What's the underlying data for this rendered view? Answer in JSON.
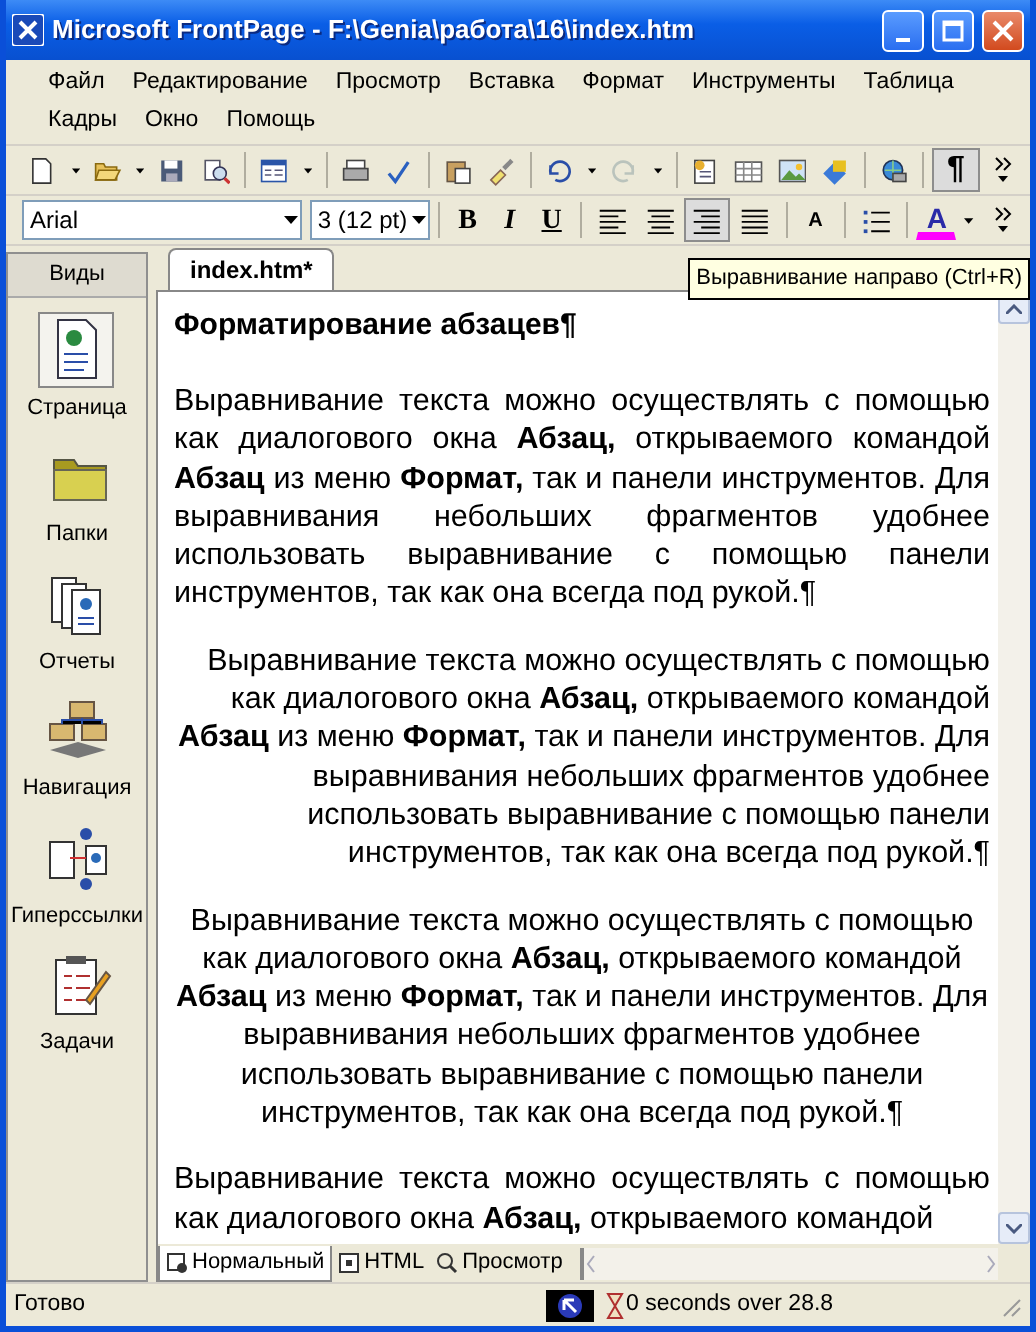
{
  "window": {
    "title": "Microsoft FrontPage - F:\\Genia\\работа\\16\\index.htm"
  },
  "menu_rows": [
    [
      "Файл",
      "Редактирование",
      "Просмотр",
      "Вставка",
      "Формат",
      "Инструменты",
      "Таблица"
    ],
    [
      "Кадры",
      "Окно",
      "Помощь"
    ]
  ],
  "standard_toolbar": {
    "redo": {
      "disabled": true
    },
    "show_formatting": {
      "glyph": "¶",
      "selected": true
    }
  },
  "formatting_toolbar": {
    "font": "Arial",
    "size": "3 (12 pt)",
    "bold": "B",
    "italic": "I",
    "underline": "U",
    "align_buttons": [
      {
        "selected": false
      },
      {
        "selected": false
      },
      {
        "selected": true
      },
      {
        "selected": false
      }
    ],
    "grow_font": "A",
    "font_color": {
      "glyph": "A",
      "color": "#ff00ff"
    }
  },
  "views": {
    "title": "Виды",
    "items": [
      {
        "label": "Страница",
        "selected": true
      },
      {
        "label": "Папки",
        "selected": false
      },
      {
        "label": "Отчеты",
        "selected": false
      },
      {
        "label": "Навигация",
        "selected": false
      },
      {
        "label": "Гиперссылки",
        "selected": false
      },
      {
        "label": "Задачи",
        "selected": false
      }
    ]
  },
  "document_tab": "index.htm*",
  "tooltip": "Выравнивание направо (Ctrl+R)",
  "document": {
    "heading": "Форматирование абзацев¶",
    "paragraphs": [
      {
        "kind": "justify",
        "text": "Выравнивание текста можно осуществлять с помощью как диалогового окна **Абзац,** открываемого командой **Абзац** из меню **Формат,** так и панели инструментов. Для выравнивания небольших фрагментов удобнее использовать выравнивание с помощью панели инструментов, так как она всегда под рукой.¶"
      },
      {
        "kind": "right",
        "text": "Выравнивание текста можно осуществлять с помощью как диалогового окна **Абзац,** открываемого командой **Абзац** из меню **Формат,** так и панели инструментов. Для выравнивания небольших фрагментов удобнее использовать выравнивание с помощью панели инструментов, так как она всегда под рукой.¶"
      },
      {
        "kind": "center",
        "text": "Выравнивание текста можно осуществлять с помощью как диалогового окна **Абзац,** открываемого командой **Абзац** из меню **Формат,** так и панели инструментов. Для выравнивания небольших фрагментов удобнее использовать выравнивание с помощью панели инструментов, так как она всегда под рукой.¶"
      },
      {
        "kind": "justify",
        "text": "Выравнивание текста можно осуществлять с помощью как диалогового окна **Абзац,** открываемого командой"
      }
    ]
  },
  "view_tabs": [
    {
      "label": "Нормальный",
      "selected": true
    },
    {
      "label": "HTML",
      "selected": false
    },
    {
      "label": "Просмотр",
      "selected": false
    }
  ],
  "status_bar": {
    "text": "Готово",
    "download_time": "0 seconds over 28.8"
  }
}
